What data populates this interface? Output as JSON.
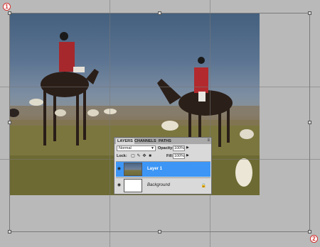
{
  "markers": {
    "top_left": "1",
    "bottom_right": "2"
  },
  "layers_panel": {
    "tabs": [
      "LAYERS",
      "CHANNELS",
      "PATHS"
    ],
    "menu_icon": "≡",
    "blend_mode": "Normal",
    "opacity_label": "Opacity:",
    "opacity_value": "100%",
    "lock_label": "Lock:",
    "lock_icons": [
      "lock-transparent-icon",
      "lock-brush-icon",
      "lock-move-icon",
      "lock-all-icon"
    ],
    "fill_label": "Fill:",
    "fill_value": "100%",
    "layers": [
      {
        "name": "Layer 1",
        "selected": true,
        "visible": true
      },
      {
        "name": "Background",
        "selected": false,
        "visible": true,
        "locked": true
      }
    ]
  },
  "colors": {
    "selection": "#3d96f5",
    "workspace": "#b9b9b9",
    "marker": "#d23030"
  }
}
